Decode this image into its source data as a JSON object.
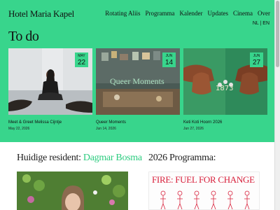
{
  "header": {
    "logo": "Hotel Maria Kapel",
    "nav": [
      "Rotating Aliis",
      "Programma",
      "Kalender",
      "Updates",
      "Cinema",
      "Over"
    ],
    "lang": "NL | EN"
  },
  "todo": {
    "heading": "To do",
    "cards": [
      {
        "month": "MAY",
        "day": "22",
        "title": "Meet & Greet Melissa Cijntje",
        "date": "May 22, 2026"
      },
      {
        "month": "JUN",
        "day": "14",
        "title": "Queer Moments",
        "date": "Jun 14, 2026",
        "overlay": "Queer Moments"
      },
      {
        "month": "JUN",
        "day": "27",
        "title": "Keti Koti Hoorn 2026",
        "date": "Jun 27, 2026"
      }
    ]
  },
  "resident": {
    "label": "Huidige resident:",
    "name": "Dagmar Bosma"
  },
  "programma": {
    "label": "2026 Programma:",
    "poster_title": "FIRE: FUEL FOR CHANGE"
  },
  "colors": {
    "accent": "#38d58c",
    "link": "#2ecc80",
    "poster_red": "#d81f3a"
  }
}
